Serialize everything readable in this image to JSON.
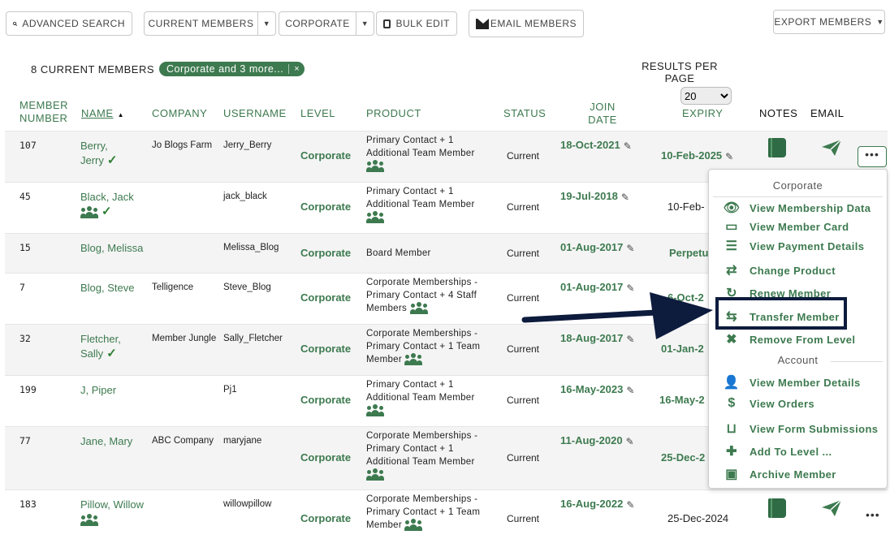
{
  "toolbar": {
    "advanced_search": "ADVANCED SEARCH",
    "current_members": "CURRENT MEMBERS",
    "corporate": "CORPORATE",
    "bulk_edit": "BULK EDIT",
    "email_members": "EMAIL MEMBERS",
    "export_members": "EXPORT MEMBERS"
  },
  "summary": {
    "count_label": "8 CURRENT MEMBERS",
    "filter_pill": "Corporate and 3 more...",
    "filter_close": "×"
  },
  "results_per_page": {
    "label": "RESULTS PER PAGE",
    "value": "20"
  },
  "columns": {
    "member_number": "MEMBER NUMBER",
    "name": "NAME",
    "company": "COMPANY",
    "username": "USERNAME",
    "level": "LEVEL",
    "product": "PRODUCT",
    "status": "STATUS",
    "join_date": "JOIN DATE",
    "expiry": "EXPIRY",
    "notes": "NOTES",
    "email": "EMAIL"
  },
  "rows": [
    {
      "number": "107",
      "name": "Berry, Jerry",
      "company": "Jo Blogs Farm",
      "username": "Jerry_Berry",
      "level": "Corporate",
      "product": "Primary Contact + 1 Additional Team Member",
      "status": "Current",
      "join": "18-Oct-2021",
      "expiry": "10-Feb-2025"
    },
    {
      "number": "45",
      "name": "Black, Jack",
      "company": "",
      "username": "jack_black",
      "level": "Corporate",
      "product": "Primary Contact + 1 Additional Team Member",
      "status": "Current",
      "join": "19-Jul-2018",
      "expiry": "10-Feb-"
    },
    {
      "number": "15",
      "name": "Blog, Melissa",
      "company": "",
      "username": "Melissa_Blog",
      "level": "Corporate",
      "product": "Board Member",
      "status": "Current",
      "join": "01-Aug-2017",
      "expiry": "Perpetu"
    },
    {
      "number": "7",
      "name": "Blog, Steve",
      "company": "Telligence",
      "username": "Steve_Blog",
      "level": "Corporate",
      "product": "Corporate Memberships - Primary Contact + 4 Staff Members",
      "status": "Current",
      "join": "01-Aug-2017",
      "expiry": "6-Oct-2"
    },
    {
      "number": "32",
      "name": "Fletcher, Sally",
      "company": "Member Jungle",
      "username": "Sally_Fletcher",
      "level": "Corporate",
      "product": "Corporate Memberships - Primary Contact + 1 Team Member",
      "status": "Current",
      "join": "18-Aug-2017",
      "expiry": "01-Jan-2"
    },
    {
      "number": "199",
      "name": "J, Piper",
      "company": "",
      "username": "Pj1",
      "level": "Corporate",
      "product": "Primary Contact + 1 Additional Team Member",
      "status": "Current",
      "join": "16-May-2023",
      "expiry": "16-May-2"
    },
    {
      "number": "77",
      "name": "Jane, Mary",
      "company": "ABC Company",
      "username": "maryjane",
      "level": "Corporate",
      "product": "Corporate Memberships - Primary Contact + 1 Additional Team Member",
      "status": "Current",
      "join": "11-Aug-2020",
      "expiry": "25-Dec-2"
    },
    {
      "number": "183",
      "name": "Pillow, Willow",
      "company": "",
      "username": "willowpillow",
      "level": "Corporate",
      "product": "Corporate Memberships - Primary Contact + 1 Team Member",
      "status": "Current",
      "join": "16-Aug-2022",
      "expiry": "25-Dec-2024"
    }
  ],
  "menu": {
    "section_corporate": "Corporate",
    "view_membership_data": "View Membership Data",
    "view_member_card": "View Member Card",
    "view_payment_details": "View Payment Details",
    "change_product": "Change Product",
    "renew_member": "Renew Member",
    "transfer_member": "Transfer Member",
    "remove_from_level": "Remove From Level",
    "section_account": "Account",
    "view_member_details": "View Member Details",
    "view_orders": "View Orders",
    "view_form_submissions": "View Form Submissions",
    "add_to_level": "Add To Level ...",
    "archive_member": "Archive Member"
  },
  "colors": {
    "brand_green": "#3d7a4f",
    "highlight_navy": "#0d1b3d"
  }
}
